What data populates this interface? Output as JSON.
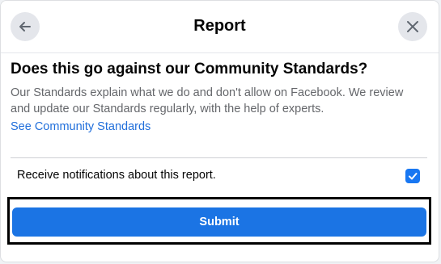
{
  "header": {
    "title": "Report",
    "back_icon": "arrow-left-icon",
    "close_icon": "close-icon"
  },
  "content": {
    "heading": "Does this go against our Community Standards?",
    "description": "Our Standards explain what we do and don't allow on Facebook. We review and update our Standards regularly, with the help of experts.",
    "link_label": "See Community Standards"
  },
  "notifications": {
    "label": "Receive notifications about this report.",
    "checked": true
  },
  "actions": {
    "submit_label": "Submit"
  },
  "colors": {
    "accent": "#1b74e4",
    "link": "#216fdb",
    "highlight_border": "#000000"
  }
}
